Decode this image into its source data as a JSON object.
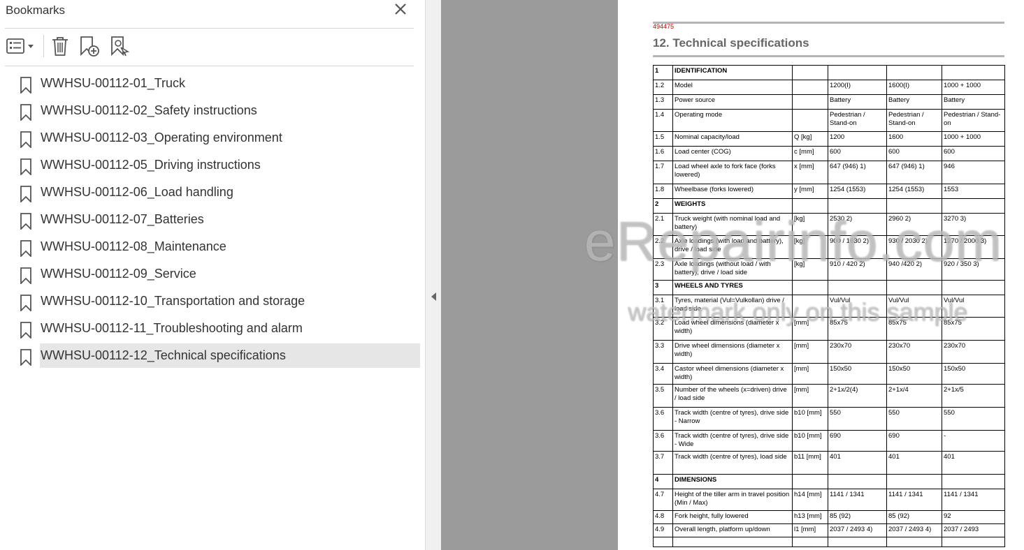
{
  "bookmarks_panel": {
    "title": "Bookmarks",
    "toolbar": {
      "options_icon": "list-options-icon",
      "delete_icon": "trash-icon",
      "new_bookmark_icon": "bookmark-add-icon",
      "find_bookmark_icon": "bookmark-find-icon"
    },
    "items": [
      {
        "label": "WWHSU-00112-01_Truck"
      },
      {
        "label": "WWHSU-00112-02_Safety instructions"
      },
      {
        "label": "WWHSU-00112-03_Operating environment"
      },
      {
        "label": "WWHSU-00112-05_Driving instructions"
      },
      {
        "label": "WWHSU-00112-06_Load handling"
      },
      {
        "label": "WWHSU-00112-07_Batteries"
      },
      {
        "label": "WWHSU-00112-08_Maintenance"
      },
      {
        "label": "WWHSU-00112-09_Service"
      },
      {
        "label": "WWHSU-00112-10_Transportation and storage"
      },
      {
        "label": "WWHSU-00112-11_Troubleshooting and alarm"
      },
      {
        "label": "WWHSU-00112-12_Technical specifications",
        "selected": true
      }
    ]
  },
  "document": {
    "code": "494475",
    "title": "12. Technical specifications",
    "watermark_line1": "eRepairinfo.com",
    "watermark_line2": "watermark only on this sample",
    "rows": [
      {
        "section": true,
        "cells": [
          "1",
          "IDENTIFICATION",
          "",
          "",
          "",
          ""
        ]
      },
      {
        "cells": [
          "1.2",
          "Model",
          "",
          "1200(I)",
          "1600(I)",
          "1000 + 1000"
        ]
      },
      {
        "cells": [
          "1.3",
          "Power source",
          "",
          "Battery",
          "Battery",
          "Battery"
        ]
      },
      {
        "cells": [
          "1.4",
          "Operating mode",
          "",
          "Pedestrian / Stand-on",
          "Pedestrian / Stand-on",
          "Pedestrian / Stand-on"
        ]
      },
      {
        "cells": [
          "1.5",
          "Nominal capacity/load",
          "Q [kg]",
          "1200",
          "1600",
          "1000 + 1000"
        ]
      },
      {
        "cells": [
          "1.6",
          "Load center (COG)",
          "c [mm]",
          "600",
          "600",
          "600"
        ]
      },
      {
        "cells": [
          "1.7",
          "Load wheel axle to fork face (forks lowered)",
          "x [mm]",
          "647 (946) 1)",
          "647 (946) 1)",
          "946"
        ]
      },
      {
        "cells": [
          "1.8",
          "Wheelbase (forks lowered)",
          "y [mm]",
          "1254 (1553)",
          "1254 (1553)",
          "1553"
        ]
      },
      {
        "section": true,
        "cells": [
          "2",
          "WEIGHTS",
          "",
          "",
          "",
          ""
        ]
      },
      {
        "cells": [
          "2.1",
          "Truck weight (with nominal load and battery)",
          "[kg]",
          "2530 2)",
          "2960 2)",
          "3270 3)"
        ]
      },
      {
        "cells": [
          "2.2",
          "Axle loadings (with load and battery), drive / load side",
          "[kg]",
          "900 / 1630 2)",
          "930 / 2030 2)",
          "1270 / 2000 3)"
        ]
      },
      {
        "cells": [
          "2.3",
          "Axle loadings (without load / with battery), drive / load side",
          "[kg]",
          "910 / 420 2)",
          "940 /420 2)",
          "920 / 350 3)"
        ]
      },
      {
        "section": true,
        "cells": [
          "3",
          "WHEELS AND TYRES",
          "",
          "",
          "",
          ""
        ]
      },
      {
        "cells": [
          "3.1",
          "Tyres, material (Vul=Vulkollan) drive / load side",
          "",
          "Vul/Vul",
          "Vul/Vul",
          "Vul/Vul"
        ]
      },
      {
        "cells": [
          "3.2",
          "Load wheel dimensions (diameter x width)",
          "[mm]",
          "85x75",
          "85x75",
          "85x75"
        ]
      },
      {
        "cells": [
          "3.3",
          "Drive wheel dimensions (diameter x width)",
          "[mm]",
          "230x70",
          "230x70",
          "230x70"
        ]
      },
      {
        "cells": [
          "3.4",
          "Castor wheel dimensions (diameter x width)",
          "[mm]",
          "150x50",
          "150x50",
          "150x50"
        ]
      },
      {
        "cells": [
          "3.5",
          "Number of the wheels (x=driven) drive / load side",
          "[mm]",
          "2+1x/2(4)",
          "2+1x/4",
          "2+1x/5"
        ]
      },
      {
        "cells": [
          "3.6",
          "Track width (centre of tyres), drive side - Narrow",
          "b10 [mm]",
          "550",
          "550",
          "550"
        ]
      },
      {
        "cells": [
          "3.6",
          "Track width (centre of tyres), drive side - Wide",
          "b10 [mm]",
          "690",
          "690",
          "-"
        ]
      },
      {
        "cells": [
          "3.7",
          "Track width (centre of tyres), load side",
          "b11 [mm]",
          "401",
          "401",
          "401"
        ]
      },
      {
        "section": true,
        "cells": [
          "4",
          "DIMENSIONS",
          "",
          "",
          "",
          ""
        ]
      },
      {
        "cells": [
          "4.7",
          "Height of the tiller arm in travel position (Min / Max)",
          "h14 [mm]",
          "1141 / 1341",
          "1141 / 1341",
          "1141 / 1341"
        ]
      },
      {
        "cells": [
          "4.8",
          "Fork height, fully lowered",
          "h13 [mm]",
          "85 (92)",
          "85 (92)",
          "92"
        ]
      },
      {
        "cells": [
          "4.9",
          "Overall length, platform up/down",
          "l1 [mm]",
          "2037 / 2493 4)",
          "2037 / 2493 4)",
          "2037 / 2493"
        ]
      },
      {
        "cells": [
          "",
          "",
          "",
          "",
          "",
          ""
        ]
      }
    ]
  }
}
